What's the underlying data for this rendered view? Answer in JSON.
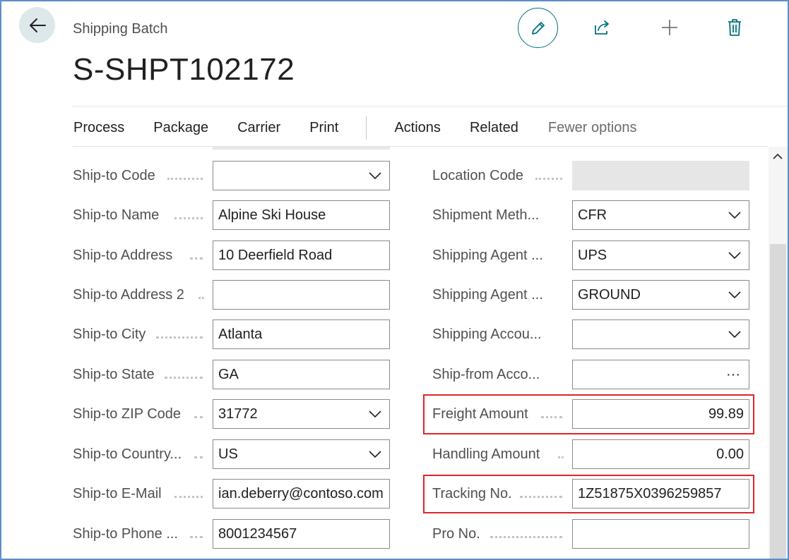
{
  "header": {
    "caption": "Shipping Batch",
    "title": "S-SHPT102172",
    "back_icon": "arrow-left-icon",
    "tool_icons": [
      "pencil-icon",
      "share-icon",
      "plus-icon",
      "trash-icon"
    ],
    "accent_color": "#00727e"
  },
  "actions": {
    "process": "Process",
    "package": "Package",
    "carrier": "Carrier",
    "print": "Print",
    "actions": "Actions",
    "related": "Related",
    "fewer": "Fewer options"
  },
  "left_fields": [
    {
      "label": "Ship-to Code",
      "value": "",
      "type": "dropdown"
    },
    {
      "label": "Ship-to Name",
      "value": "Alpine Ski House",
      "type": "text"
    },
    {
      "label": "Ship-to Address",
      "value": "10 Deerfield Road",
      "type": "text"
    },
    {
      "label": "Ship-to Address 2",
      "value": "",
      "type": "text"
    },
    {
      "label": "Ship-to City",
      "value": "Atlanta",
      "type": "text"
    },
    {
      "label": "Ship-to State",
      "value": "GA",
      "type": "text"
    },
    {
      "label": "Ship-to ZIP Code",
      "value": "31772",
      "type": "dropdown"
    },
    {
      "label": "Ship-to Country...",
      "value": "US",
      "type": "dropdown"
    },
    {
      "label": "Ship-to E-Mail",
      "value": "ian.deberry@contoso.com",
      "type": "text"
    },
    {
      "label": "Ship-to Phone ...",
      "value": "8001234567",
      "type": "text"
    }
  ],
  "right_fields": [
    {
      "label": "Location Code",
      "value": "",
      "type": "readonly"
    },
    {
      "label": "Shipment Meth...",
      "value": "CFR",
      "type": "dropdown"
    },
    {
      "label": "Shipping Agent ...",
      "value": "UPS",
      "type": "dropdown"
    },
    {
      "label": "Shipping Agent ...",
      "value": "GROUND",
      "type": "dropdown"
    },
    {
      "label": "Shipping Accou...",
      "value": "",
      "type": "dropdown"
    },
    {
      "label": "Ship-from Acco...",
      "value": "",
      "type": "lookup",
      "lookup_symbol": "···"
    },
    {
      "label": "Freight Amount",
      "value": "99.89",
      "type": "number"
    },
    {
      "label": "Handling Amount",
      "value": "0.00",
      "type": "number"
    },
    {
      "label": "Tracking No.",
      "value": "1Z51875X0396259857",
      "type": "text"
    },
    {
      "label": "Pro No.",
      "value": "",
      "type": "text"
    }
  ],
  "highlight_color": "#e0242a"
}
